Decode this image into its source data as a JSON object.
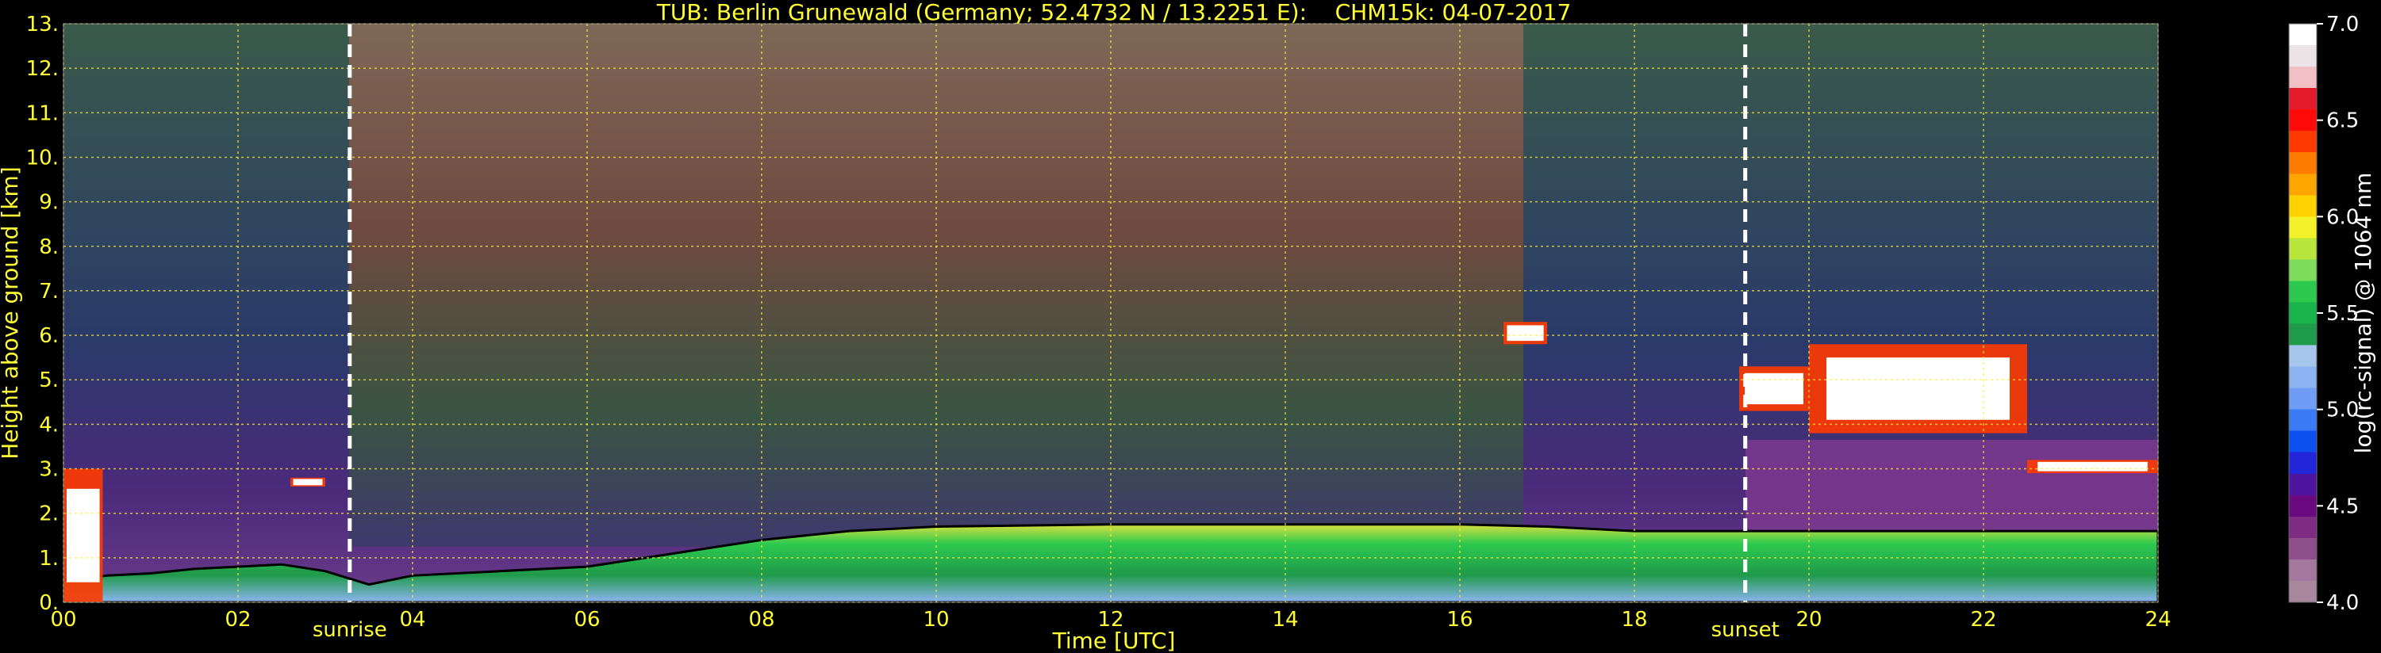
{
  "chart_data": {
    "type": "heatmap",
    "title": "TUB: Berlin Grunewald (Germany; 52.4732 N / 13.2251 E):    CHM15k: 04-07-2017",
    "xlabel": "Time [UTC]",
    "ylabel": "Height above ground [km]",
    "xlim": [
      0,
      24
    ],
    "ylim": [
      0,
      13
    ],
    "x_ticks": [
      "00",
      "02",
      "04",
      "06",
      "08",
      "10",
      "12",
      "14",
      "16",
      "18",
      "20",
      "22",
      "24"
    ],
    "y_ticks": [
      "0.",
      "1.",
      "2.",
      "3.",
      "4.",
      "5.",
      "6.",
      "7.",
      "8.",
      "9.",
      "10.",
      "11.",
      "12.",
      "13."
    ],
    "grid": true,
    "markers": [
      {
        "label": "sunrise",
        "time": 3.28
      },
      {
        "label": "sunset",
        "time": 19.27
      }
    ],
    "colorbar": {
      "label": "log(rc-signal) @ 1064 nm",
      "range": [
        4.0,
        7.0
      ],
      "ticks": [
        "4.0",
        "4.5",
        "5.0",
        "5.5",
        "6.0",
        "6.5",
        "7.0"
      ],
      "colors": [
        "#a8879f",
        "#a4789e",
        "#8f4e8c",
        "#7e2b82",
        "#6a0a80",
        "#50159e",
        "#2325d8",
        "#0d50f0",
        "#3a7af3",
        "#6f9cf5",
        "#8db4f2",
        "#a7c6ee",
        "#1f9a4a",
        "#19b34c",
        "#2dc94f",
        "#7ddc5c",
        "#b8e63d",
        "#f4f12a",
        "#ffd100",
        "#ffa500",
        "#ff7b00",
        "#ff3a00",
        "#ff0a0a",
        "#e31b2a",
        "#f2bfc4",
        "#ebe3e6",
        "#ffffff"
      ]
    },
    "boundary_layer_top_km": [
      [
        0.0,
        0.5
      ],
      [
        0.5,
        0.6
      ],
      [
        1.0,
        0.65
      ],
      [
        1.5,
        0.75
      ],
      [
        2.0,
        0.8
      ],
      [
        2.5,
        0.85
      ],
      [
        3.0,
        0.7
      ],
      [
        3.5,
        0.4
      ],
      [
        4.0,
        0.6
      ],
      [
        5.0,
        0.7
      ],
      [
        6.0,
        0.8
      ],
      [
        7.0,
        1.1
      ],
      [
        8.0,
        1.4
      ],
      [
        9.0,
        1.6
      ],
      [
        10.0,
        1.7
      ],
      [
        12.0,
        1.75
      ],
      [
        14.0,
        1.75
      ],
      [
        16.0,
        1.75
      ],
      [
        17.0,
        1.7
      ],
      [
        18.0,
        1.6
      ],
      [
        19.0,
        1.6
      ],
      [
        20.0,
        1.6
      ],
      [
        22.0,
        1.6
      ],
      [
        24.0,
        1.6
      ]
    ],
    "clouds_km": [
      {
        "t0": 0.0,
        "t1": 0.45,
        "base": 0.0,
        "top": 3.0
      },
      {
        "t0": 2.6,
        "t1": 3.0,
        "base": 2.6,
        "top": 2.8
      },
      {
        "t0": 16.5,
        "t1": 17.0,
        "base": 5.8,
        "top": 6.3
      },
      {
        "t0": 19.2,
        "t1": 20.0,
        "base": 4.3,
        "top": 5.3
      },
      {
        "t0": 20.0,
        "t1": 22.5,
        "base": 3.8,
        "top": 5.8
      },
      {
        "t0": 22.5,
        "t1": 24.0,
        "base": 2.9,
        "top": 3.2
      }
    ]
  }
}
